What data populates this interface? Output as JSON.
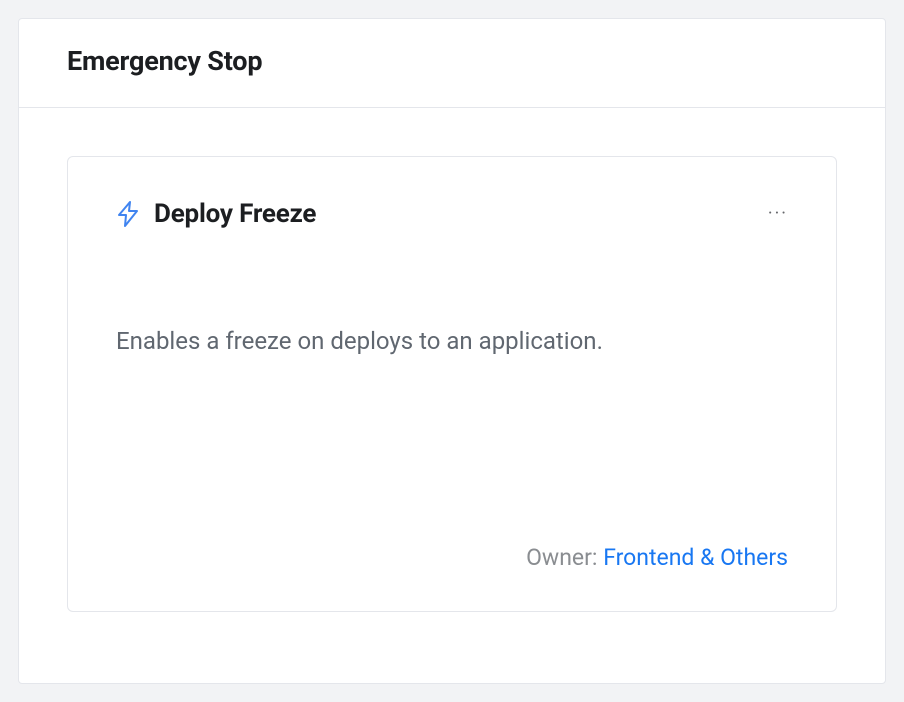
{
  "panel": {
    "title": "Emergency Stop"
  },
  "card": {
    "icon": "bolt-icon",
    "title": "Deploy Freeze",
    "description": "Enables a freeze on deploys to an application.",
    "menu_glyph": "···",
    "owner_label": "Owner: ",
    "owner_name": "Frontend & Others"
  }
}
